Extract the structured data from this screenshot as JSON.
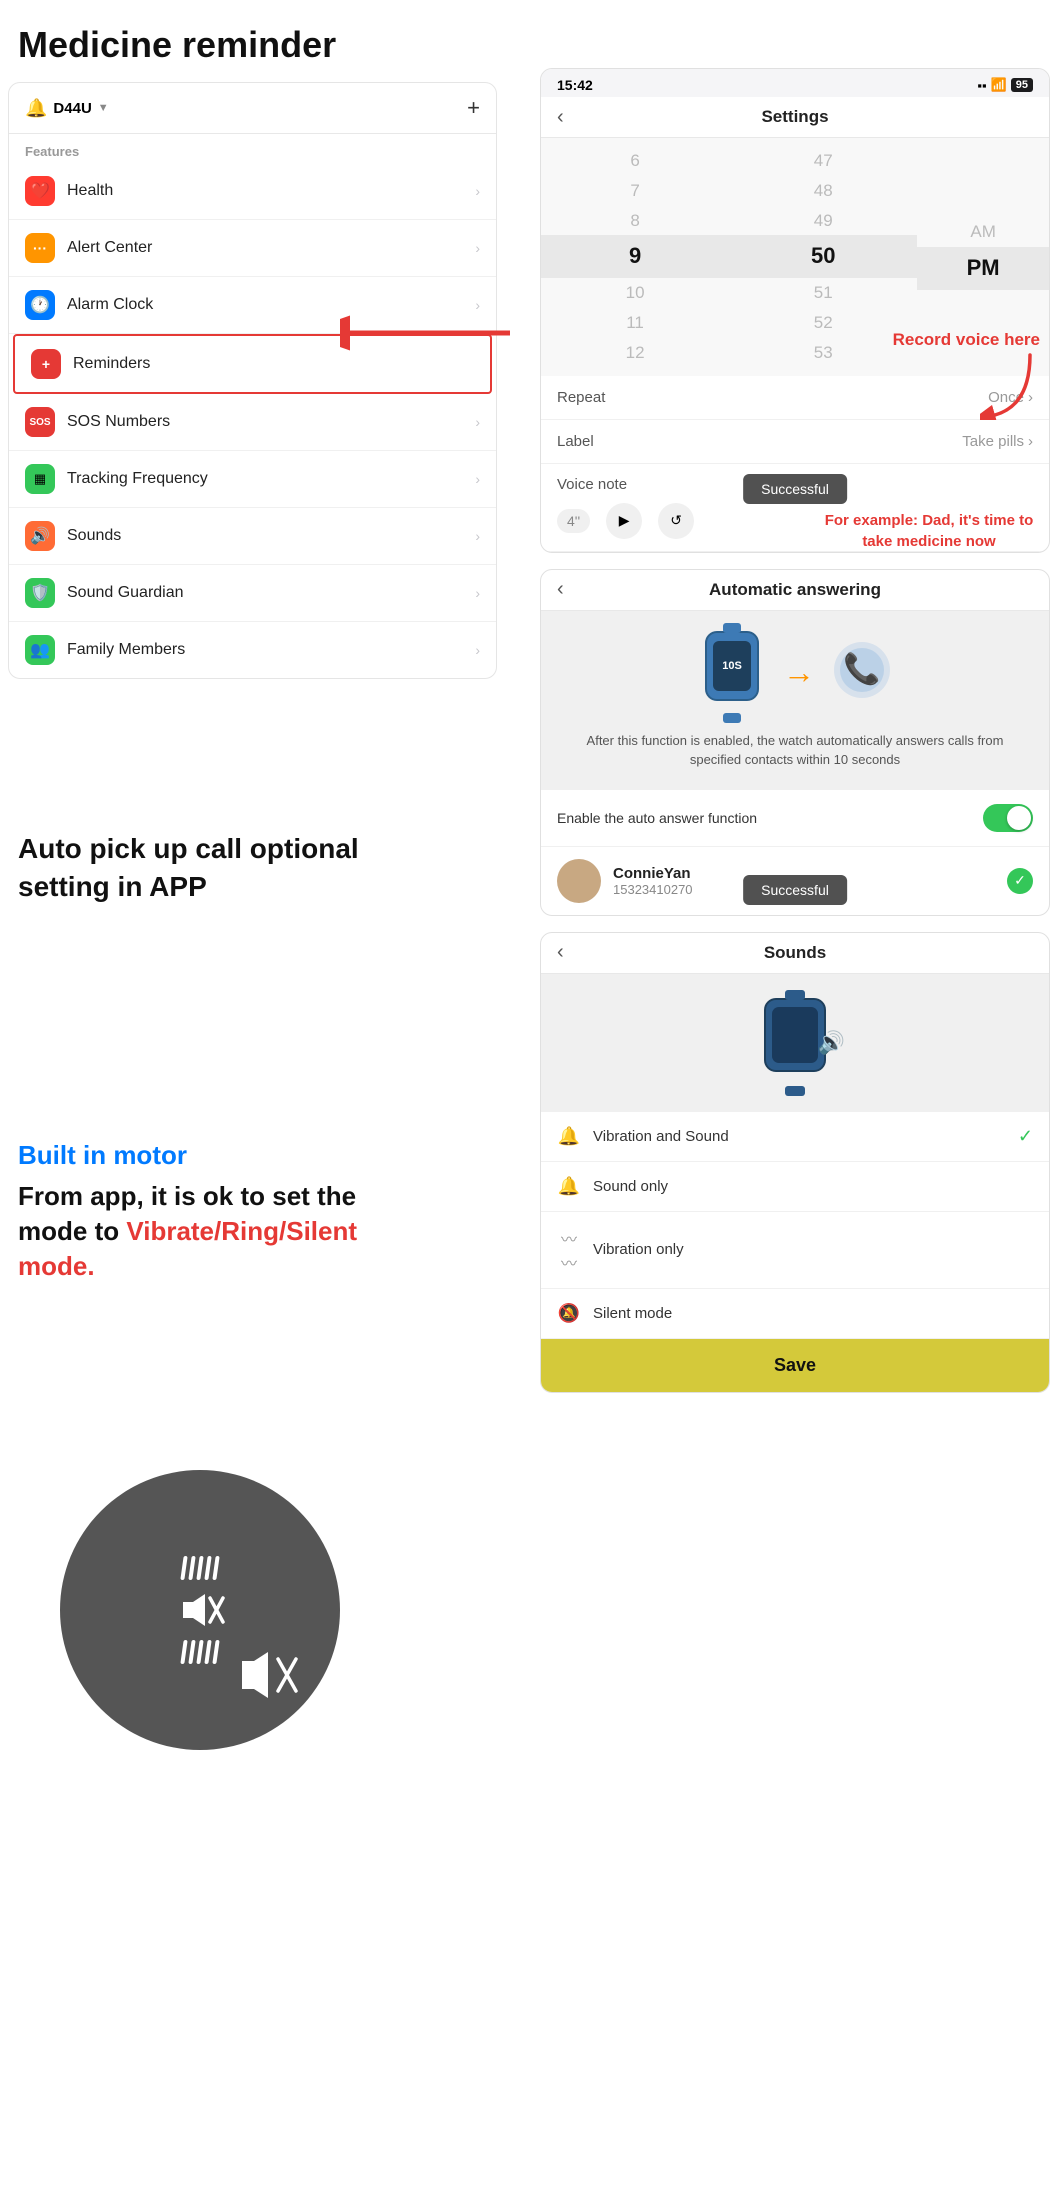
{
  "page": {
    "title": "Medicine reminder"
  },
  "app_panel": {
    "device_name": "D44U",
    "add_label": "+",
    "features_label": "Features",
    "menu_items": [
      {
        "id": "health",
        "label": "Health",
        "icon": "❤️",
        "icon_class": "icon-health"
      },
      {
        "id": "alert",
        "label": "Alert Center",
        "icon": "🟧",
        "icon_class": "icon-alert"
      },
      {
        "id": "alarm",
        "label": "Alarm Clock",
        "icon": "🕐",
        "icon_class": "icon-alarm"
      },
      {
        "id": "reminders",
        "label": "Reminders",
        "icon": "➕",
        "icon_class": "icon-remind",
        "highlighted": true
      },
      {
        "id": "sos",
        "label": "SOS Numbers",
        "icon": "SOS",
        "icon_class": "icon-sos"
      },
      {
        "id": "tracking",
        "label": "Tracking Frequency",
        "icon": "▦",
        "icon_class": "icon-track"
      },
      {
        "id": "sounds",
        "label": "Sounds",
        "icon": "🔊",
        "icon_class": "icon-sounds"
      },
      {
        "id": "guardian",
        "label": "Sound Guardian",
        "icon": "🛡️",
        "icon_class": "icon-guardian"
      },
      {
        "id": "family",
        "label": "Family Members",
        "icon": "👥",
        "icon_class": "icon-family"
      }
    ]
  },
  "settings_screen": {
    "status_time": "15:42",
    "battery": "95",
    "nav_title": "Settings",
    "time_picker": {
      "hours": [
        "6",
        "7",
        "8",
        "9",
        "10",
        "11",
        "12"
      ],
      "minutes": [
        "47",
        "48",
        "49",
        "50",
        "51",
        "52",
        "53"
      ],
      "ampm": [
        "AM",
        "PM"
      ],
      "selected_hour": "9",
      "selected_minute": "50",
      "selected_ampm": "PM"
    },
    "repeat_label": "Repeat",
    "repeat_value": "Once",
    "label_label": "Label",
    "label_value": "Take pills",
    "voice_note_label": "Voice note",
    "voice_duration": "4''",
    "toast_text": "Successful"
  },
  "annotations": {
    "record_voice": "Record voice here",
    "example_text": "For example: Dad, it's time to take medicine now",
    "auto_pickup_title": "Auto pick up call optional setting in APP",
    "built_in_motor_title": "Built in motor",
    "built_in_motor_desc": "From app, it is ok to set the mode to ",
    "vibrate_ring_text": "Vibrate/Ring/Silent mode."
  },
  "auto_answer_screen": {
    "nav_title": "Automatic answering",
    "watch_label": "10S",
    "desc": "After this function is enabled, the watch automatically answers calls from specified contacts within 10 seconds",
    "toggle_label": "Enable the auto answer function",
    "contact_name": "ConnieYan",
    "contact_phone": "15323410270",
    "toast_text": "Successful"
  },
  "sounds_screen": {
    "nav_title": "Sounds",
    "options": [
      {
        "id": "vibration_sound",
        "label": "Vibration and Sound",
        "checked": true,
        "icon": "🔔"
      },
      {
        "id": "sound_only",
        "label": "Sound only",
        "checked": false,
        "icon": "🔔"
      },
      {
        "id": "vibration_only",
        "label": "Vibration only",
        "checked": false,
        "icon": "〰"
      },
      {
        "id": "silent",
        "label": "Silent mode",
        "checked": false,
        "icon": "🔕"
      }
    ],
    "save_label": "Save"
  }
}
